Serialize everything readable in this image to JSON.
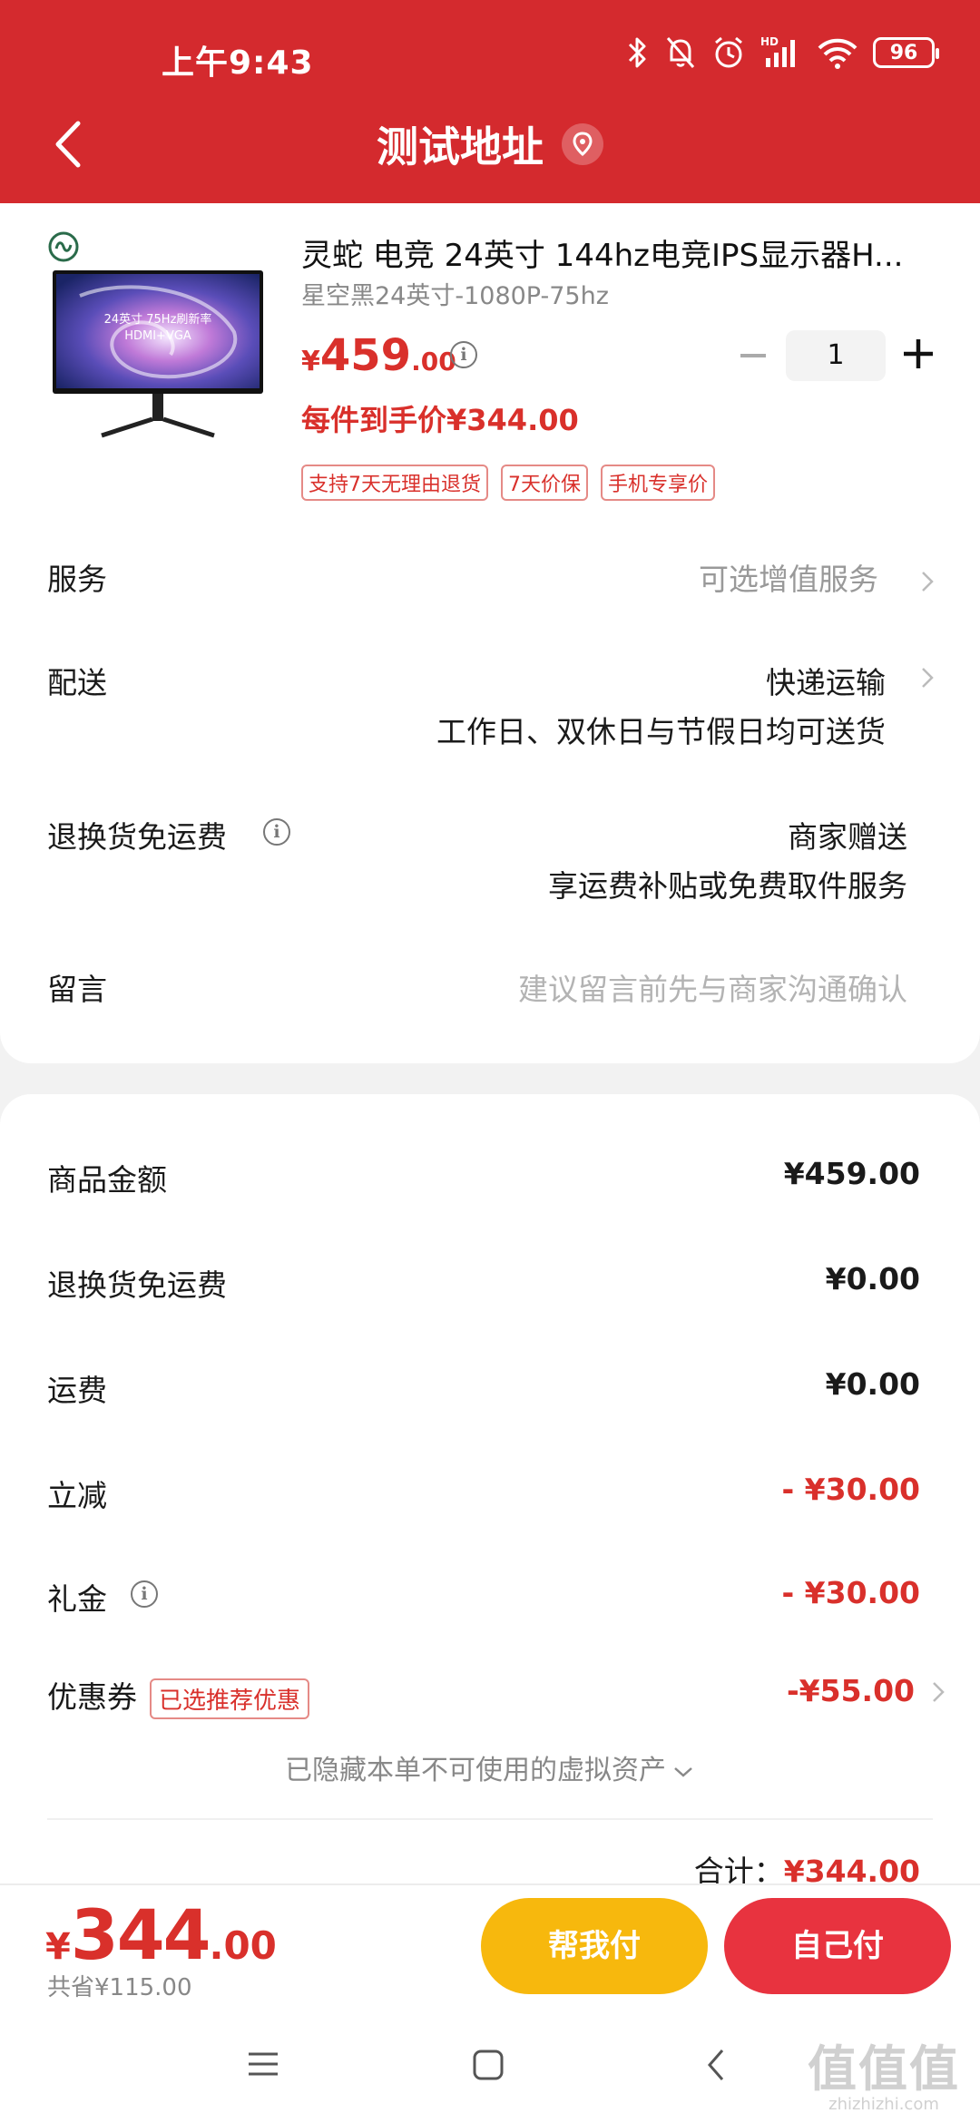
{
  "status_bar": {
    "time": "上午9:43",
    "battery": "96"
  },
  "nav": {
    "title": "测试地址"
  },
  "product": {
    "title": "灵蛇 电竞 24英寸 144hz电竞IPS显示器H...",
    "sku": "星空黑24英寸-1080P-75hz",
    "image_text_1": "24英寸 75Hz刷新率",
    "image_text_2": "HDMI+VGA",
    "price_symbol": "¥",
    "price_int": "459",
    "price_dec": ".00",
    "quantity": "1",
    "unit_price_text": "每件到手价¥344.00",
    "tags": [
      "支持7天无理由退货",
      "7天价保",
      "手机专享价"
    ]
  },
  "rows": {
    "service_label": "服务",
    "service_value": "可选增值服务",
    "delivery_label": "配送",
    "delivery_value": "快递运输",
    "delivery_note": "工作日、双休日与节假日均可送货",
    "return_label": "退换货免运费",
    "return_value": "商家赠送",
    "return_note": "享运费补贴或免费取件服务",
    "message_label": "留言",
    "message_placeholder": "建议留言前先与商家沟通确认"
  },
  "summary": {
    "goods_label": "商品金额",
    "goods_value": "¥459.00",
    "return_fee_label": "退换货免运费",
    "return_fee_value": "¥0.00",
    "shipping_label": "运费",
    "shipping_value": "¥0.00",
    "discount_label": "立减",
    "discount_value": "- ¥30.00",
    "gift_label": "礼金",
    "gift_value": "- ¥30.00",
    "coupon_label": "优惠券",
    "coupon_tag": "已选推荐优惠",
    "coupon_value": "-¥55.00",
    "hidden_assets": "已隐藏本单不可使用的虚拟资产",
    "total_label": "合计：",
    "total_value": "¥344.00"
  },
  "bottom": {
    "price_symbol": "¥",
    "price_int": "344",
    "price_dec": ".00",
    "saved": "共省¥115.00",
    "help_pay": "帮我付",
    "self_pay": "自己付"
  },
  "watermark": {
    "big": "值值值",
    "small": "zhizhizhi.com"
  },
  "colors": {
    "header": "#d42a2e",
    "price_red": "#d9302b",
    "help_button": "#f7b80d",
    "self_button": "#e8333f"
  }
}
